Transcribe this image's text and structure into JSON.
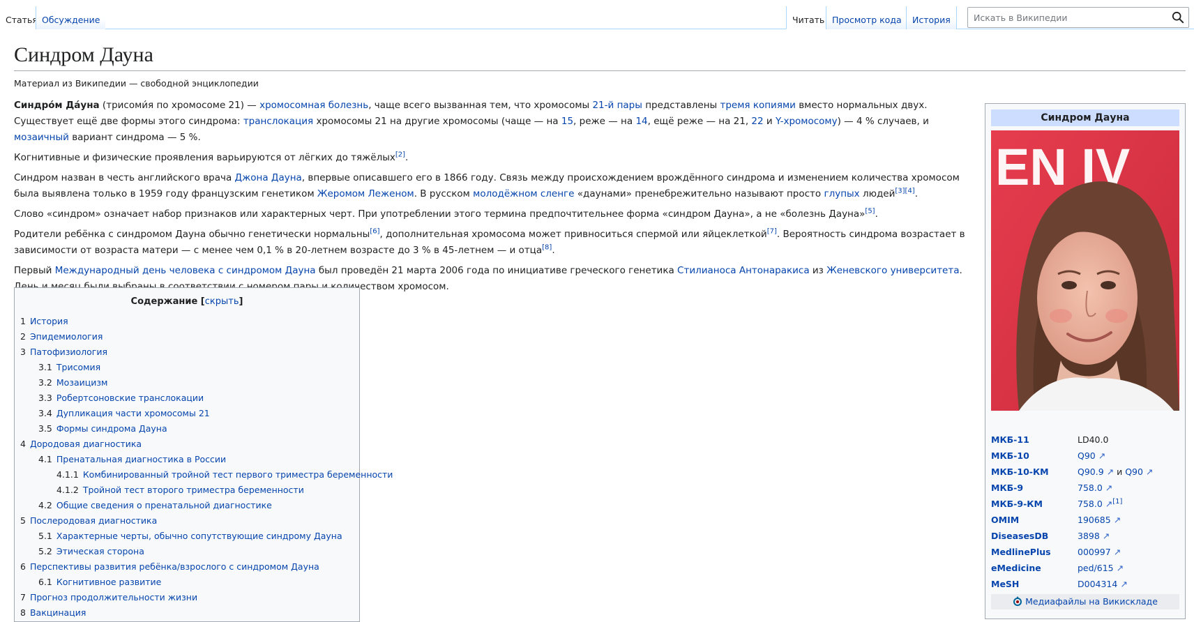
{
  "tabs": {
    "left": [
      {
        "label": "Статья"
      },
      {
        "label": "Обсуждение"
      }
    ],
    "right": [
      {
        "label": "Читать"
      },
      {
        "label": "Просмотр кода"
      },
      {
        "label": "История"
      }
    ]
  },
  "search": {
    "placeholder": "Искать в Википедии"
  },
  "page": {
    "title": "Синдром Дауна",
    "tagline": "Материал из Википедии — свободной энциклопедии"
  },
  "article": {
    "p1": {
      "lead_bold": "Синдро́м Да́уна",
      "t1": " (трисоми́я по хромосоме 21) — ",
      "l1": "хромосомная болезнь",
      "t2": ", чаще всего вызванная тем, что хромосомы ",
      "l2": "21-й пары",
      "t3": " представлены ",
      "l3": "тремя копиями",
      "t4": " вместо нормальных двух. Существует ещё две формы этого синдрома: ",
      "l4": "транслокация",
      "t5": " хромосомы 21 на другие хромосомы (чаще — на ",
      "l5": "15",
      "t6": ", реже — на ",
      "l6": "14",
      "t7": ", ещё реже — на 21, ",
      "l7": "22",
      "t8": " и ",
      "l8": "Y-хромосому",
      "t9": ") — 4 % случаев, и ",
      "l9": "мозаичный",
      "t10": " вариант синдрома — 5 %."
    },
    "p2": {
      "t1": "Когнитивные и физические проявления варьируются от лёгких до тяжёлых",
      "ref": "[2]",
      "t2": "."
    },
    "p3": {
      "t1": "Синдром назван в честь английского врача ",
      "l1": "Джона Дауна",
      "t2": ", впервые описавшего его в 1866 году. Связь между происхождением врождённого синдрома и изменением количества хромосом была выявлена только в 1959 году французским генетиком ",
      "l2": "Жеромом Леженом",
      "t3": ". В русском ",
      "l3": "молодёжном сленге",
      "t4": " «даунами» пренебрежительно называют просто ",
      "l4": "глупых",
      "t5": " людей",
      "ref": "[3][4]",
      "t6": "."
    },
    "p4": {
      "t1": "Слово «синдром» означает набор признаков или характерных черт. При употреблении этого термина предпочтительнее форма «синдром Дауна», а не «болезнь Дауна»",
      "ref": "[5]",
      "t2": "."
    },
    "p5": {
      "t1": "Родители ребёнка с синдромом Дауна обычно генетически нормальны",
      "ref1": "[6]",
      "t2": ", дополнительная хромосома может привноситься спермой или яйцеклеткой",
      "ref2": "[7]",
      "t3": ". Вероятность синдрома возрастает в зависимости от возраста матери — с менее чем 0,1 % в 20-летнем возрасте до 3 % в 45-летнем — и отца",
      "ref3": "[8]",
      "t4": "."
    },
    "p6": {
      "t1": "Первый ",
      "l1": "Международный день человека с синдромом Дауна",
      "t2": " был проведён 21 марта 2006 года по инициативе греческого генетика ",
      "l2": "Стилианоса Антонаракиса",
      "t3": " из ",
      "l3": "Женевского университета",
      "t4": ". День и месяц были выбраны в соответствии с номером пары и количеством хромосом."
    }
  },
  "toc": {
    "title": "Содержание",
    "hide_open": "[",
    "hide_label": "скрыть",
    "hide_close": "]",
    "items": [
      {
        "num": "1",
        "label": "История",
        "level": 1
      },
      {
        "num": "2",
        "label": "Эпидемиология",
        "level": 1
      },
      {
        "num": "3",
        "label": "Патофизиология",
        "level": 1
      },
      {
        "num": "3.1",
        "label": "Трисомия",
        "level": 2
      },
      {
        "num": "3.2",
        "label": "Мозаицизм",
        "level": 2
      },
      {
        "num": "3.3",
        "label": "Робертсоновские транслокации",
        "level": 2
      },
      {
        "num": "3.4",
        "label": "Дупликация части хромосомы 21",
        "level": 2
      },
      {
        "num": "3.5",
        "label": "Формы синдрома Дауна",
        "level": 2
      },
      {
        "num": "4",
        "label": "Дородовая диагностика",
        "level": 1
      },
      {
        "num": "4.1",
        "label": "Пренатальная диагностика в России",
        "level": 2
      },
      {
        "num": "4.1.1",
        "label": "Комбинированный тройной тест первого триместра беременности",
        "level": 3
      },
      {
        "num": "4.1.2",
        "label": "Тройной тест второго триместра беременности",
        "level": 3
      },
      {
        "num": "4.2",
        "label": "Общие сведения о пренатальной диагностике",
        "level": 2
      },
      {
        "num": "5",
        "label": "Послеродовая диагностика",
        "level": 1
      },
      {
        "num": "5.1",
        "label": "Характерные черты, обычно сопутствующие синдрому Дауна",
        "level": 2
      },
      {
        "num": "5.2",
        "label": "Этическая сторона",
        "level": 2
      },
      {
        "num": "6",
        "label": "Перспективы развития ребёнка/взрослого с синдромом Дауна",
        "level": 1
      },
      {
        "num": "6.1",
        "label": "Когнитивное развитие",
        "level": 2
      },
      {
        "num": "7",
        "label": "Прогноз продолжительности жизни",
        "level": 1
      },
      {
        "num": "8",
        "label": "Вакцинация",
        "level": 1
      }
    ]
  },
  "infobox": {
    "title": "Синдром Дауна",
    "photo_sign_text": "EN  IV",
    "rows": [
      {
        "key": "МКБ-11",
        "value": "LD40.0"
      },
      {
        "key": "МКБ-10",
        "value": "Q90"
      },
      {
        "key": "МКБ-10-КМ",
        "value": "Q90.9",
        "and": " и ",
        "value2": "Q90"
      },
      {
        "key": "МКБ-9",
        "value": "758.0"
      },
      {
        "key": "МКБ-9-КМ",
        "value": "758.0",
        "ref": "[1]"
      },
      {
        "key": "OMIM",
        "value": "190685"
      },
      {
        "key": "DiseasesDB",
        "value": "3898"
      },
      {
        "key": "MedlinePlus",
        "value": "000997"
      },
      {
        "key": "eMedicine",
        "value": "ped/615"
      },
      {
        "key": "MeSH",
        "value": "D004314"
      }
    ],
    "commons_label": "Медиафайлы на Викискладе"
  },
  "icons": {
    "search": "search-icon",
    "external": "external-link-icon",
    "commons": "commons-logo-icon"
  },
  "colors": {
    "link": "#0645ad",
    "tab_border": "#a7d7f9",
    "infobox_header": "#ccddff",
    "box_bg": "#f8f9fa"
  }
}
